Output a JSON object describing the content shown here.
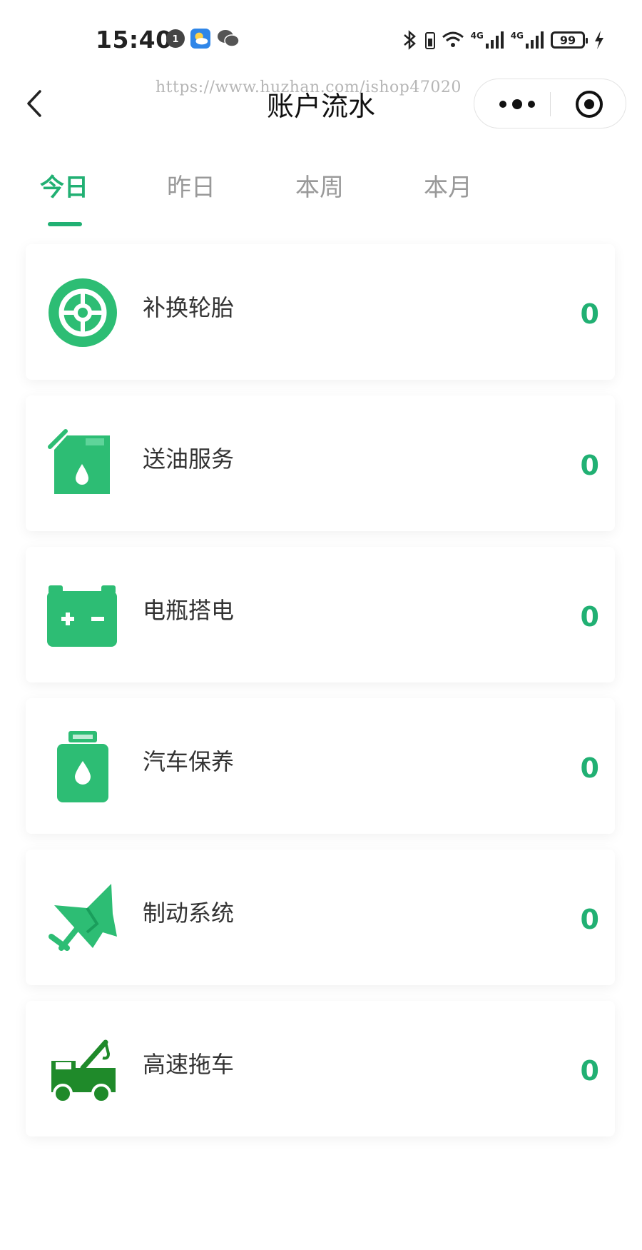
{
  "status_bar": {
    "time": "15:40",
    "battery": "99",
    "network_1": "4G",
    "network_2": "4G"
  },
  "nav": {
    "title": "账户流水",
    "watermark": "https://www.huzhan.com/ishop47020"
  },
  "tabs": [
    {
      "label": "今日",
      "active": true
    },
    {
      "label": "昨日",
      "active": false
    },
    {
      "label": "本周",
      "active": false
    },
    {
      "label": "本月",
      "active": false
    }
  ],
  "items": [
    {
      "label": "补换轮胎",
      "value": "0",
      "icon": "tire-icon"
    },
    {
      "label": "送油服务",
      "value": "0",
      "icon": "fuel-can-icon"
    },
    {
      "label": "电瓶搭电",
      "value": "0",
      "icon": "battery-icon"
    },
    {
      "label": "汽车保养",
      "value": "0",
      "icon": "oil-bottle-icon"
    },
    {
      "label": "制动系统",
      "value": "0",
      "icon": "brake-icon"
    },
    {
      "label": "高速拖车",
      "value": "0",
      "icon": "tow-truck-icon"
    }
  ],
  "colors": {
    "accent": "#21b073",
    "icon_green": "#2dbd74",
    "tow_green": "#1f8a2a",
    "text": "#333333",
    "inactive_tab": "#999999"
  }
}
